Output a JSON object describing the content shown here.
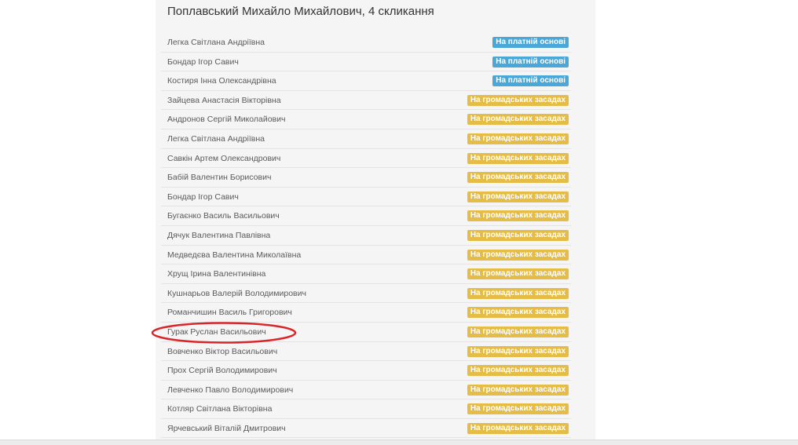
{
  "title": "Поплавський Михайло Михайлович, 4 скликання",
  "colors": {
    "paid_badge": "#49a8d8",
    "public_badge": "#e5bc45",
    "highlight_circle": "#d9262b"
  },
  "rows": [
    {
      "name": "Легка Світлана Андріївна",
      "badge": "На платній основі",
      "kind": "paid"
    },
    {
      "name": "Бондар Ігор Савич",
      "badge": "На платній основі",
      "kind": "paid"
    },
    {
      "name": "Костиря Інна Олександрівна",
      "badge": "На платній основі",
      "kind": "paid"
    },
    {
      "name": "Зайцева Анастасія Вікторівна",
      "badge": "На громадських засадах",
      "kind": "public"
    },
    {
      "name": "Андронов Сергій Миколайович",
      "badge": "На громадських засадах",
      "kind": "public"
    },
    {
      "name": "Легка Світлана Андріївна",
      "badge": "На громадських засадах",
      "kind": "public"
    },
    {
      "name": "Савкін Артем Олександрович",
      "badge": "На громадських засадах",
      "kind": "public"
    },
    {
      "name": "Бабій Валентин Борисович",
      "badge": "На громадських засадах",
      "kind": "public"
    },
    {
      "name": "Бондар Ігор Савич",
      "badge": "На громадських засадах",
      "kind": "public"
    },
    {
      "name": "Бугаєнко Василь Васильович",
      "badge": "На громадських засадах",
      "kind": "public"
    },
    {
      "name": "Дячук Валентина Павлівна",
      "badge": "На громадських засадах",
      "kind": "public"
    },
    {
      "name": "Медведєва Валентина Миколаївна",
      "badge": "На громадських засадах",
      "kind": "public"
    },
    {
      "name": "Хрущ Ірина Валентинівна",
      "badge": "На громадських засадах",
      "kind": "public"
    },
    {
      "name": "Кушнарьов Валерій Володимирович",
      "badge": "На громадських засадах",
      "kind": "public"
    },
    {
      "name": "Романчишин Василь Григорович",
      "badge": "На громадських засадах",
      "kind": "public"
    },
    {
      "name": "Гурак Руслан Васильович",
      "badge": "На громадських засадах",
      "kind": "public"
    },
    {
      "name": "Вовченко Віктор Васильович",
      "badge": "На громадських засадах",
      "kind": "public"
    },
    {
      "name": "Прох Сергій Володимирович",
      "badge": "На громадських засадах",
      "kind": "public"
    },
    {
      "name": "Левченко Павло Володимирович",
      "badge": "На громадських засадах",
      "kind": "public"
    },
    {
      "name": "Котляр Світлана Вікторівна",
      "badge": "На громадських засадах",
      "kind": "public"
    },
    {
      "name": "Ярчевський Віталій Дмитрович",
      "badge": "На громадських засадах",
      "kind": "public"
    }
  ]
}
